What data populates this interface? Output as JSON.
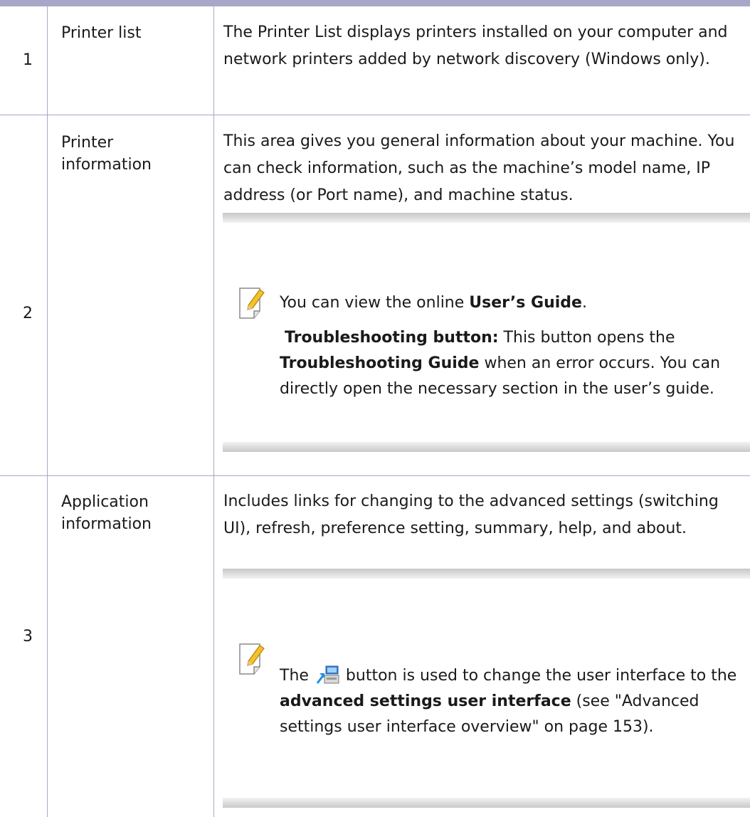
{
  "rows": [
    {
      "number": "1",
      "label": "Printer list",
      "description": "The Printer List displays printers installed on your computer and network printers added by network discovery (Windows only)."
    },
    {
      "number": "2",
      "label": "Printer information",
      "description": "This area gives you general information about your machine. You can check information, such as the machine’s model name, IP address (or Port name), and machine status.",
      "note": {
        "p1_before": "You can view the online ",
        "p1_bold": "User’s Guide",
        "p1_after": ".",
        "p2_bold1": "Troubleshooting button:",
        "p2_text1": " This button opens the ",
        "p2_bold2": "Troubleshooting Guide",
        "p2_text2": " when an error occurs. You can directly open the necessary section in the user’s guide."
      }
    },
    {
      "number": "3",
      "label": "Application information",
      "description": "Includes links for changing to the advanced settings (switching UI), refresh, preference setting, summary, help, and about.",
      "note": {
        "t1": "The ",
        "t2": " button is used to change the user interface to the ",
        "bold": "advanced settings user interface",
        "t3": " (see \"Advanced settings user interface overview\" on page 153)."
      }
    }
  ],
  "icons": {
    "note": "note-pencil-icon",
    "switch_ui": "switch-ui-icon"
  },
  "colors": {
    "rule": "#a7a7c8",
    "note_band": "#c8c8c8"
  }
}
